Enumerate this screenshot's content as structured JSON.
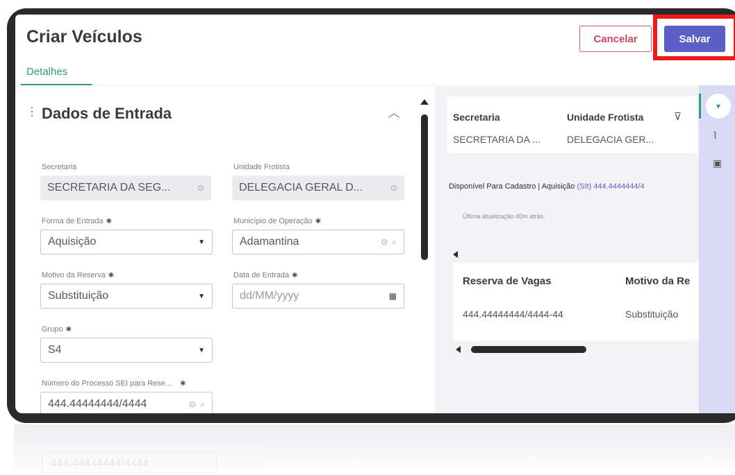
{
  "header": {
    "title": "Criar Veículos",
    "cancel_label": "Cancelar",
    "save_label": "Salvar"
  },
  "tabs": [
    {
      "label": "Detalhes",
      "active": true
    }
  ],
  "section": {
    "title": "Dados de Entrada"
  },
  "form": {
    "secretaria": {
      "label": "Secretaria",
      "value": "SECRETARIA DA SEG..."
    },
    "unidade_frotista": {
      "label": "Unidade Frotista",
      "value": "DELEGACIA GERAL D..."
    },
    "forma_entrada": {
      "label": "Forma de Entrada",
      "value": "Aquisição"
    },
    "municipio_operacao": {
      "label": "Município de Operação",
      "value": "Adamantina"
    },
    "motivo_reserva": {
      "label": "Motivo da Reserva",
      "value": "Substituição"
    },
    "data_entrada": {
      "label": "Data de Entrada",
      "placeholder": "dd/MM/yyyy"
    },
    "grupo": {
      "label": "Grupo",
      "value": "S4"
    },
    "numero_processo": {
      "label": "Número do Processo SEI para Rese...",
      "value": "444.44444444/4444"
    }
  },
  "required_mark": "✱",
  "side_panel": {
    "summary": {
      "col1_header": "Secretaria",
      "col2_header": "Unidade Frotista",
      "col1_value": "SECRETARIA DA ...",
      "col2_value": "DELEGACIA GER..."
    },
    "status": {
      "prefix": "Disponível Para Cadastro | Aquisição",
      "link": "(SIt) 444.4444444/4"
    },
    "last_update": "Última atualização 40m atrás.",
    "table": {
      "headers": [
        "Reserva de Vagas",
        "Motivo da Re"
      ],
      "rows": [
        [
          "444.44444444/4444-44",
          "Substituição"
        ]
      ]
    }
  },
  "reflection_text": "444.44444444/4444",
  "colors": {
    "accent": "#5b5fc7",
    "tab_active": "#2f9a7d",
    "cancel": "#d0465a",
    "highlight": "#ee1a1a",
    "rail": "#d9d9f5"
  }
}
